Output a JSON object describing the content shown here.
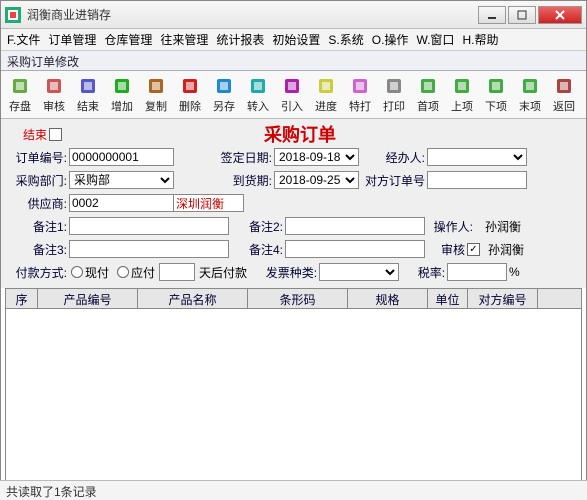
{
  "window": {
    "title": "润衡商业进销存"
  },
  "menu": [
    "F.文件",
    "订单管理",
    "仓库管理",
    "往来管理",
    "统计报表",
    "初始设置",
    "S.系统",
    "O.操作",
    "W.窗口",
    "H.帮助"
  ],
  "subtitle": "采购订单修改",
  "toolbar": [
    {
      "label": "存盘",
      "name": "save"
    },
    {
      "label": "审核",
      "name": "audit"
    },
    {
      "label": "结束",
      "name": "finish"
    },
    {
      "label": "增加",
      "name": "add"
    },
    {
      "label": "复制",
      "name": "copy"
    },
    {
      "label": "删除",
      "name": "delete"
    },
    {
      "label": "另存",
      "name": "saveas"
    },
    {
      "label": "转入",
      "name": "import"
    },
    {
      "label": "引入",
      "name": "introduce"
    },
    {
      "label": "进度",
      "name": "progress"
    },
    {
      "label": "特打",
      "name": "special"
    },
    {
      "label": "打印",
      "name": "print"
    },
    {
      "label": "首项",
      "name": "first"
    },
    {
      "label": "上项",
      "name": "prev"
    },
    {
      "label": "下项",
      "name": "next"
    },
    {
      "label": "末项",
      "name": "last"
    },
    {
      "label": "返回",
      "name": "back"
    }
  ],
  "form": {
    "title": "采购订单",
    "finish_label": "结束",
    "order_no_label": "订单编号:",
    "order_no": "0000000001",
    "sign_date_label": "签定日期:",
    "sign_date": "2018-09-18",
    "handler_label": "经办人:",
    "handler": "",
    "dept_label": "采购部门:",
    "dept": "采购部",
    "arrive_date_label": "到货期:",
    "arrive_date": "2018-09-25",
    "other_no_label": "对方订单号",
    "other_no": "",
    "supplier_label": "供应商:",
    "supplier_code": "0002",
    "supplier_name": "深圳润衡",
    "remark1_label": "备注1:",
    "remark1": "",
    "remark2_label": "备注2:",
    "remark2": "",
    "operator_label": "操作人:",
    "operator": "孙润衡",
    "remark3_label": "备注3:",
    "remark3": "",
    "remark4_label": "备注4:",
    "remark4": "",
    "audit_label": "审核",
    "auditor": "孙润衡",
    "pay_label": "付款方式:",
    "pay_now": "现付",
    "pay_later": "应付",
    "pay_days_suffix": "天后付款",
    "pay_days": "",
    "invoice_label": "发票种类:",
    "invoice": "",
    "tax_label": "税率:",
    "tax": "",
    "tax_unit": "%"
  },
  "grid": {
    "columns": [
      "序号",
      "产品编号",
      "产品名称",
      "条形码",
      "规格",
      "单位",
      "对方编号"
    ],
    "widths": [
      32,
      100,
      110,
      100,
      80,
      40,
      70
    ]
  },
  "status": "共读取了1条记录"
}
